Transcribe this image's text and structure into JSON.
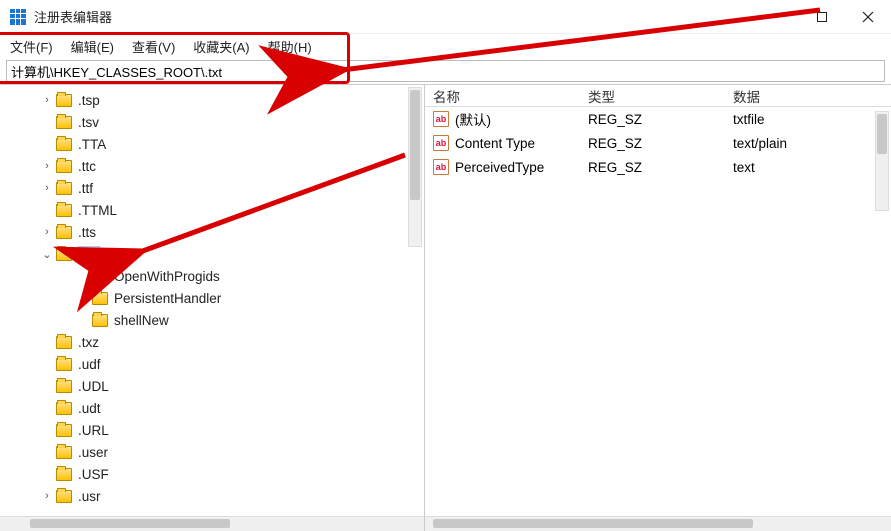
{
  "window": {
    "title": "注册表编辑器"
  },
  "menu": {
    "file": "文件(F)",
    "edit": "编辑(E)",
    "view": "查看(V)",
    "favorites": "收藏夹(A)",
    "help": "帮助(H)"
  },
  "address": {
    "path": "计算机\\HKEY_CLASSES_ROOT\\.txt"
  },
  "tree": [
    {
      "label": ".tsp",
      "expander": ">",
      "depth": 0
    },
    {
      "label": ".tsv",
      "expander": "",
      "depth": 0
    },
    {
      "label": ".TTA",
      "expander": "",
      "depth": 0
    },
    {
      "label": ".ttc",
      "expander": ">",
      "depth": 0
    },
    {
      "label": ".ttf",
      "expander": ">",
      "depth": 0
    },
    {
      "label": ".TTML",
      "expander": "",
      "depth": 0
    },
    {
      "label": ".tts",
      "expander": ">",
      "depth": 0
    },
    {
      "label": ".txt",
      "expander": "v",
      "depth": 0,
      "selected": true
    },
    {
      "label": "OpenWithProgids",
      "expander": "",
      "depth": 1
    },
    {
      "label": "PersistentHandler",
      "expander": "",
      "depth": 1
    },
    {
      "label": "shellNew",
      "expander": "",
      "depth": 1
    },
    {
      "label": ".txz",
      "expander": "",
      "depth": 0
    },
    {
      "label": ".udf",
      "expander": "",
      "depth": 0
    },
    {
      "label": ".UDL",
      "expander": "",
      "depth": 0
    },
    {
      "label": ".udt",
      "expander": "",
      "depth": 0
    },
    {
      "label": ".URL",
      "expander": "",
      "depth": 0
    },
    {
      "label": ".user",
      "expander": "",
      "depth": 0
    },
    {
      "label": ".USF",
      "expander": "",
      "depth": 0
    },
    {
      "label": ".usr",
      "expander": ">",
      "depth": 0
    }
  ],
  "columns": {
    "name": "名称",
    "type": "类型",
    "data": "数据"
  },
  "values": [
    {
      "name": "(默认)",
      "type": "REG_SZ",
      "data": "txtfile"
    },
    {
      "name": "Content Type",
      "type": "REG_SZ",
      "data": "text/plain"
    },
    {
      "name": "PerceivedType",
      "type": "REG_SZ",
      "data": "text"
    }
  ]
}
